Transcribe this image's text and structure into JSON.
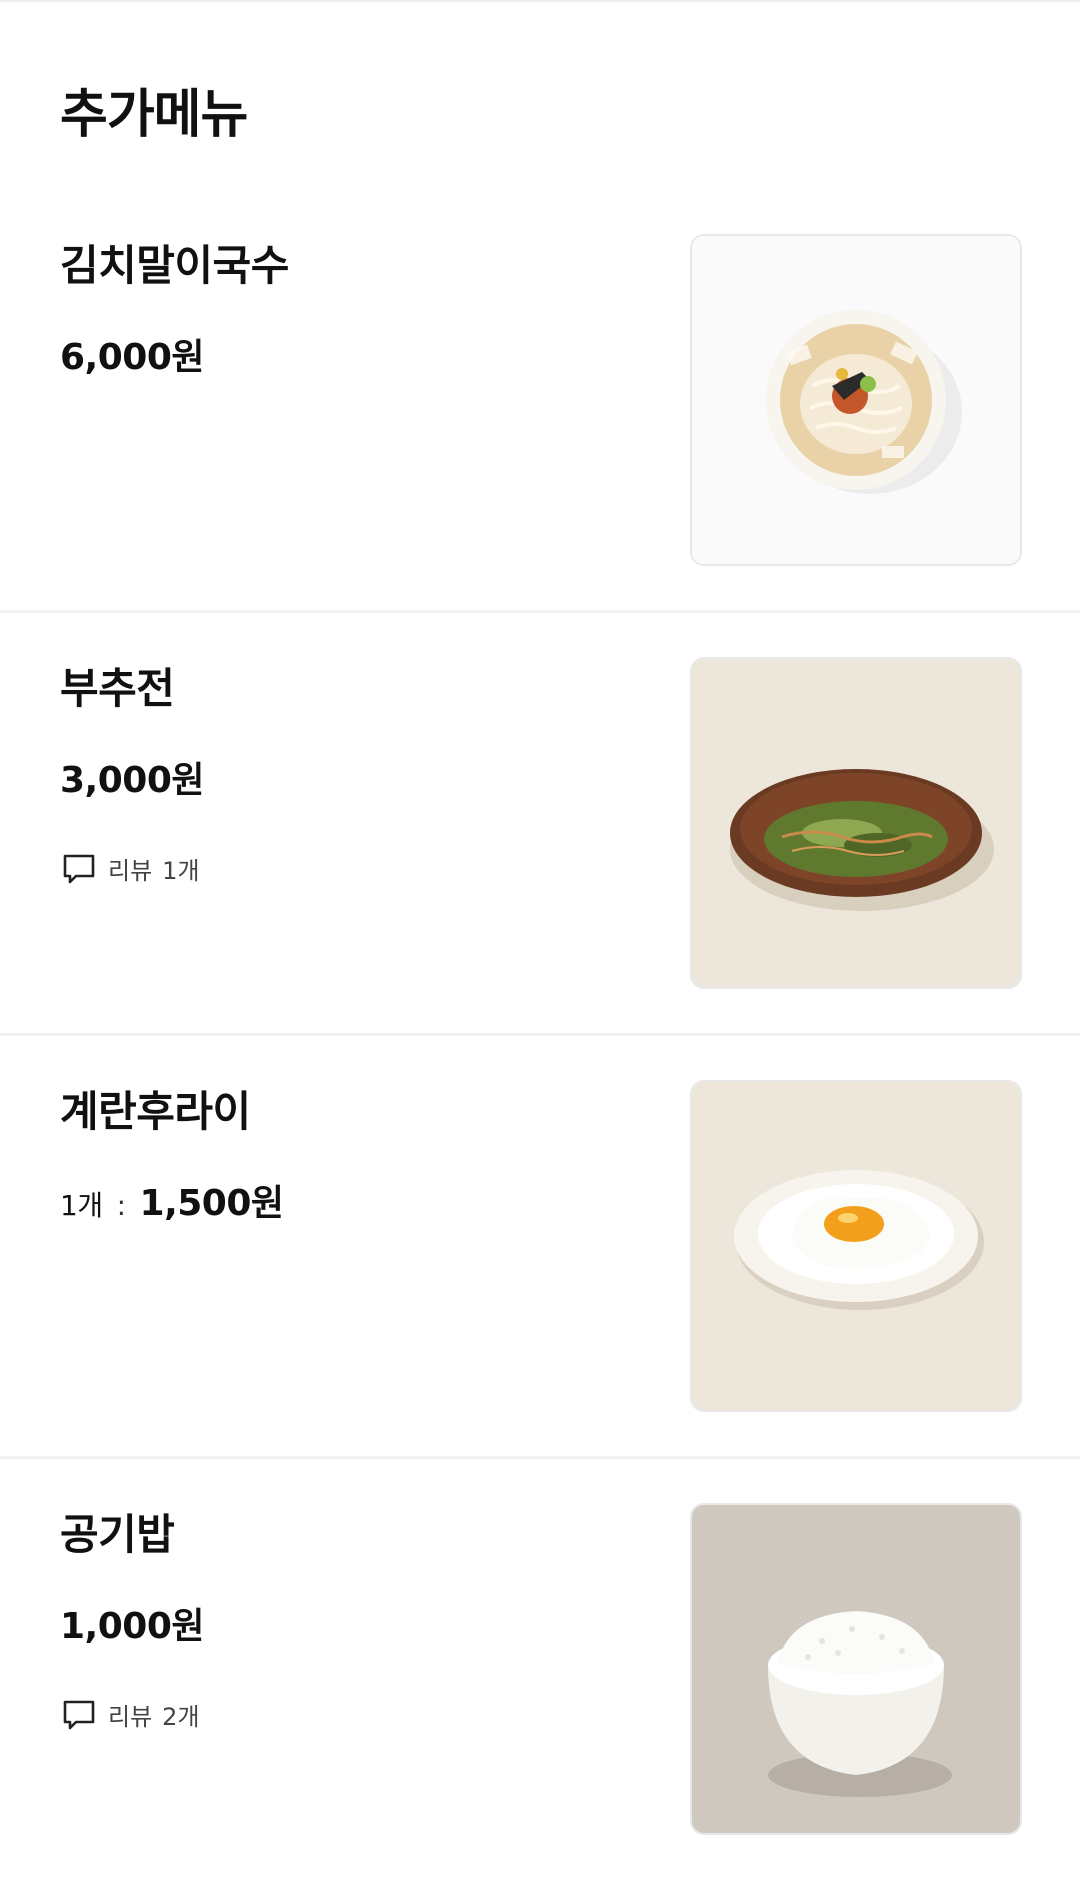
{
  "section": {
    "title": "추가메뉴"
  },
  "menu": {
    "items": [
      {
        "name": "김치말이국수",
        "price": "6,000원"
      },
      {
        "name": "부추전",
        "price": "3,000원",
        "review_label": "리뷰",
        "review_count": "1개"
      },
      {
        "name": "계란후라이",
        "unit": "1개",
        "sep": ":",
        "price": "1,500원"
      },
      {
        "name": "공기밥",
        "price": "1,000원",
        "review_label": "리뷰",
        "review_count": "2개"
      }
    ]
  }
}
